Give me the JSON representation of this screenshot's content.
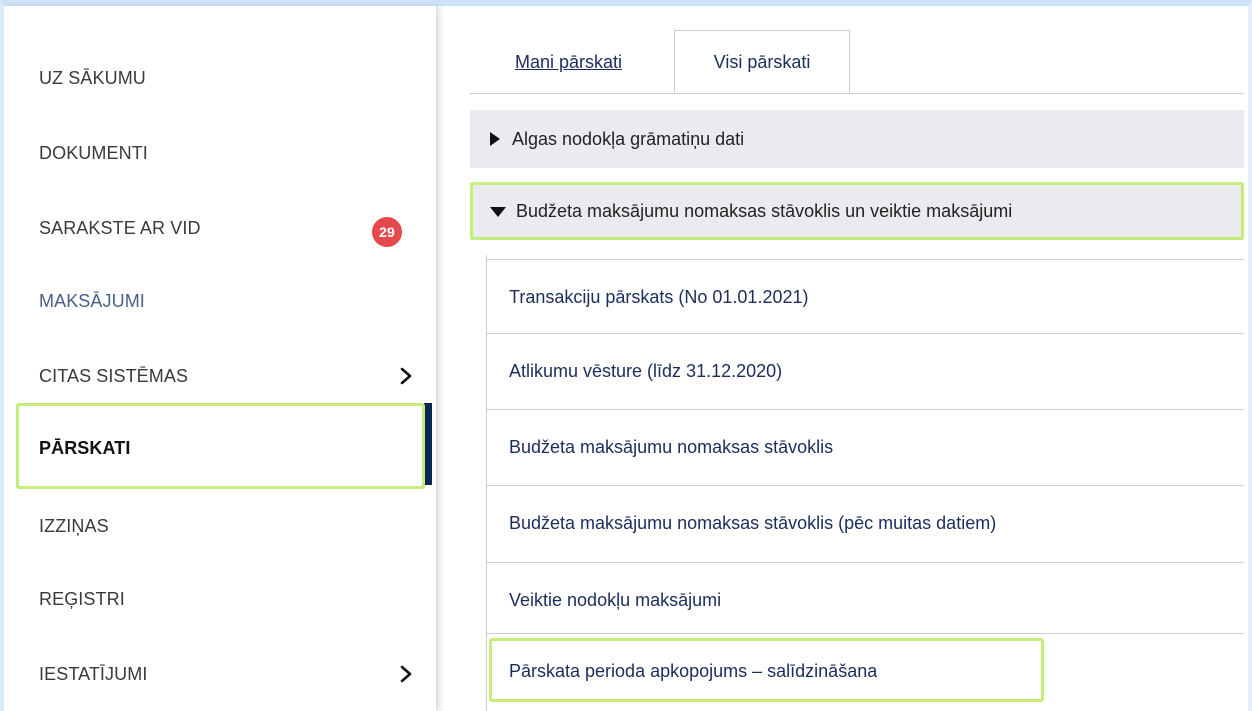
{
  "sidebar": {
    "items": [
      {
        "label": "UZ SĀKUMU"
      },
      {
        "label": "DOKUMENTI"
      },
      {
        "label": "SARAKSTE AR VID",
        "badge": "29"
      },
      {
        "label": "MAKSĀJUMI"
      },
      {
        "label": "CITAS SISTĒMAS",
        "icon": "chevron-right-icon"
      },
      {
        "label": "PĀRSKATI"
      },
      {
        "label": "IZZIŅAS"
      },
      {
        "label": "REĢISTRI"
      },
      {
        "label": "IESTATĪJUMI",
        "icon": "chevron-right-icon"
      }
    ]
  },
  "tabs": [
    {
      "label": "Mani pārskati"
    },
    {
      "label": "Visi pārskati"
    }
  ],
  "accordion": [
    {
      "label": "Algas nodokļa grāmatiņu dati",
      "icon": "triangle-right-icon"
    },
    {
      "label": "Budžeta maksājumu nomaksas stāvoklis un veiktie maksājumi",
      "icon": "triangle-down-icon"
    }
  ],
  "reports": [
    {
      "label": "Transakciju pārskats (No 01.01.2021)"
    },
    {
      "label": "Atlikumu vēsture (līdz 31.12.2020)"
    },
    {
      "label": "Budžeta maksājumu nomaksas stāvoklis"
    },
    {
      "label": "Budžeta maksājumu nomaksas stāvoklis (pēc muitas datiem)"
    },
    {
      "label": "Veiktie nodokļu maksājumi"
    },
    {
      "label": "Pārskata perioda apkopojums – salīdzināšana"
    }
  ],
  "colors": {
    "highlight": "#c6ec7a",
    "active_bar": "#0b2653",
    "badge": "#e5484d",
    "link": "#1b2d5c"
  }
}
